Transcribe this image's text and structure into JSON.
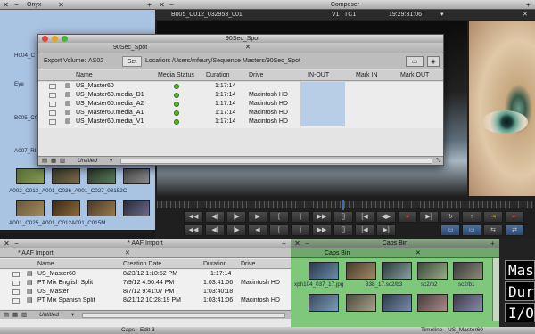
{
  "onyx": {
    "title": "Onyx",
    "items": [
      "H004_C",
      "Eye",
      "B005_C012_",
      "A007_RI",
      "A002_C013_A001_C036_A001_C027_03152C",
      "A001_C025_A001_C012A001_C015M"
    ]
  },
  "composer": {
    "title": "Composer",
    "clip": "B005_C012_032953_001",
    "track": "V1",
    "tc_label": "TC1",
    "timecode": "19:29:31:06"
  },
  "spot": {
    "title": "90Sec_Spot",
    "export_label": "Export Volume:",
    "export_value": "AS02",
    "set_button": "Set",
    "location_label": "Location:",
    "location_value": "/Users/mfeury/Sequence Masters/90Sec_Spot",
    "columns": [
      "Name",
      "Media Status",
      "Duration",
      "Drive",
      "IN-OUT",
      "Mark IN",
      "Mark OUT"
    ],
    "rows": [
      {
        "name": "US_Master60",
        "duration": "1:17:14",
        "drive": ""
      },
      {
        "name": "US_Master60.media_D1",
        "duration": "1:17:14",
        "drive": "Macintosh HD"
      },
      {
        "name": "US_Master60.media_A2",
        "duration": "1:17:14",
        "drive": "Macintosh HD"
      },
      {
        "name": "US_Master60.media_A1",
        "duration": "1:17:14",
        "drive": "Macintosh HD"
      },
      {
        "name": "US_Master60.media_V1",
        "duration": "1:17:14",
        "drive": "Macintosh HD"
      }
    ],
    "view": "Untitled"
  },
  "aaf": {
    "title": "* AAF Import",
    "tab": "* AAF Import",
    "columns": [
      "Name",
      "Creation Date",
      "Duration",
      "Drive"
    ],
    "rows": [
      {
        "name": "US_Master60",
        "date": "8/23/12 1:10:52 PM",
        "duration": "1:17:14",
        "drive": ""
      },
      {
        "name": "PT Mix English Split",
        "date": "7/9/12 4:50:44 PM",
        "duration": "1:03:41:06",
        "drive": "Macintosh HD"
      },
      {
        "name": "US_Master",
        "date": "8/7/12 9:41:07 PM",
        "duration": "1:03:40:18",
        "drive": ""
      },
      {
        "name": "PT Mix Spanish Split",
        "date": "8/21/12 10:28:19 PM",
        "duration": "1:03:41:06",
        "drive": "Macintosh HD"
      }
    ],
    "view": "Untitled"
  },
  "caps": {
    "title": "Caps Bin",
    "tab": "Caps Bin",
    "labels": [
      "xph104_037_17.jpg",
      "338_17.sc2/b3",
      "sc2/b2",
      "sc2/b1"
    ]
  },
  "overlay": {
    "lines": [
      "Mas",
      "Dur",
      "I/O"
    ]
  },
  "bottom": {
    "left": "Caps - Edit 3",
    "right": "Timeline - US_Master60"
  },
  "colors": {
    "accent": "#3d6fb0",
    "caps_green": "#7fc77a",
    "media_ok": "#5cb82e"
  }
}
